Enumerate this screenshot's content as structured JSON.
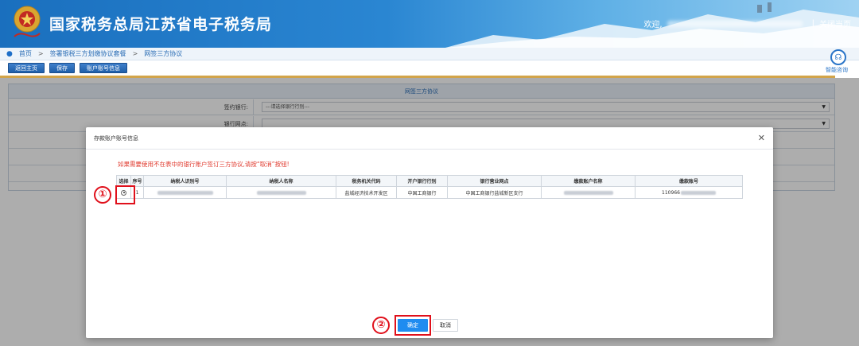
{
  "header": {
    "title": "国家税务总局江苏省电子税务局",
    "welcome": "欢迎,",
    "separator": "|",
    "close_label": "关闭当页"
  },
  "breadcrumb": {
    "items": [
      "首页",
      "签署银税三方划缴协议套餐",
      "网签三方协议"
    ],
    "separator": ">"
  },
  "toolbar": {
    "back_label": "返回主页",
    "save_label": "保存",
    "account_label": "账户账号信息"
  },
  "assistant": {
    "label": "智能咨询"
  },
  "form": {
    "title": "网签三方协议",
    "rows": [
      {
        "label": "签约银行:",
        "value": "---请选择银行行别---"
      },
      {
        "label": "银行网点:",
        "value": ""
      }
    ]
  },
  "modal": {
    "title": "存款账户账号信息",
    "warning": "如果需要使用不在表中的银行账户签订三方协议,请按“取消”按钮!",
    "columns": [
      "选择",
      "序号",
      "纳税人识别号",
      "纳税人名称",
      "税务机关代码",
      "开户银行行别",
      "银行营业网点",
      "缴款账户名称",
      "缴款账号"
    ],
    "rows": [
      {
        "index": "1",
        "tax_office": "盐城经济技术开发区",
        "bank_type": "中国工商银行",
        "branch": "中国工商银行盐城新区支行",
        "account_prefix": "110966"
      }
    ],
    "ok_label": "确定",
    "cancel_label": "取消"
  },
  "annotations": {
    "marker1": "①",
    "marker2": "②"
  },
  "colors": {
    "header_blue": "#1a6fbe",
    "annotation_red": "#e0101b",
    "primary_button": "#1f8cf0",
    "warning_text": "#e03a2e"
  }
}
